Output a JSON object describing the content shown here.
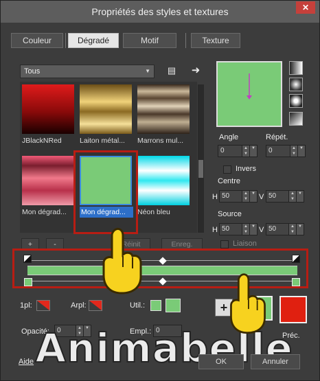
{
  "window": {
    "title": "Propriétés des styles et textures",
    "close_glyph": "✕"
  },
  "tabs": [
    {
      "label": "Couleur",
      "active": false
    },
    {
      "label": "Dégradé",
      "active": true
    },
    {
      "label": "Motif",
      "active": false
    },
    {
      "label": "Texture",
      "active": false
    }
  ],
  "category": {
    "selected": "Tous"
  },
  "gradients": [
    {
      "label": "JBlackNRed",
      "selected": false
    },
    {
      "label": "Laiton métal...",
      "selected": false
    },
    {
      "label": "Marrons mul...",
      "selected": false
    },
    {
      "label": "Mon dégrad...",
      "selected": false
    },
    {
      "label": "Mon dégrad...",
      "selected": true
    },
    {
      "label": "Néon bleu",
      "selected": false
    }
  ],
  "list_buttons": {
    "add": "+",
    "remove": "-",
    "reset": "Réinit",
    "save": "Enreg."
  },
  "preview": {
    "color": "#7acb77"
  },
  "angle": {
    "label": "Angle",
    "value": "0"
  },
  "repeat": {
    "label": "Répét.",
    "value": "0"
  },
  "invert": {
    "label": "Invers",
    "checked": false
  },
  "center": {
    "label": "Centre",
    "h_label": "H",
    "h_value": "50",
    "v_label": "V",
    "v_value": "50"
  },
  "source": {
    "label": "Source",
    "h_label": "H",
    "h_value": "50",
    "v_label": "V",
    "v_value": "50"
  },
  "link": {
    "label": "Liaison",
    "checked": false
  },
  "stops": {
    "fpl_label": "1pl:",
    "arpl_label": "Arpl:",
    "util_label": "Util.:",
    "opacity_label": "Opacité:",
    "opacity_value": "0",
    "empl_label": "Empl.:",
    "empl_value": "0",
    "stop_color": "#7acb77"
  },
  "colors": {
    "current": "#7acb77",
    "previous": "#e02010",
    "prev_label": "Préc.",
    "add_glyph": "+"
  },
  "footer": {
    "help": "Aide",
    "ok": "OK",
    "cancel": "Annuler"
  },
  "watermark": "Animabelle"
}
